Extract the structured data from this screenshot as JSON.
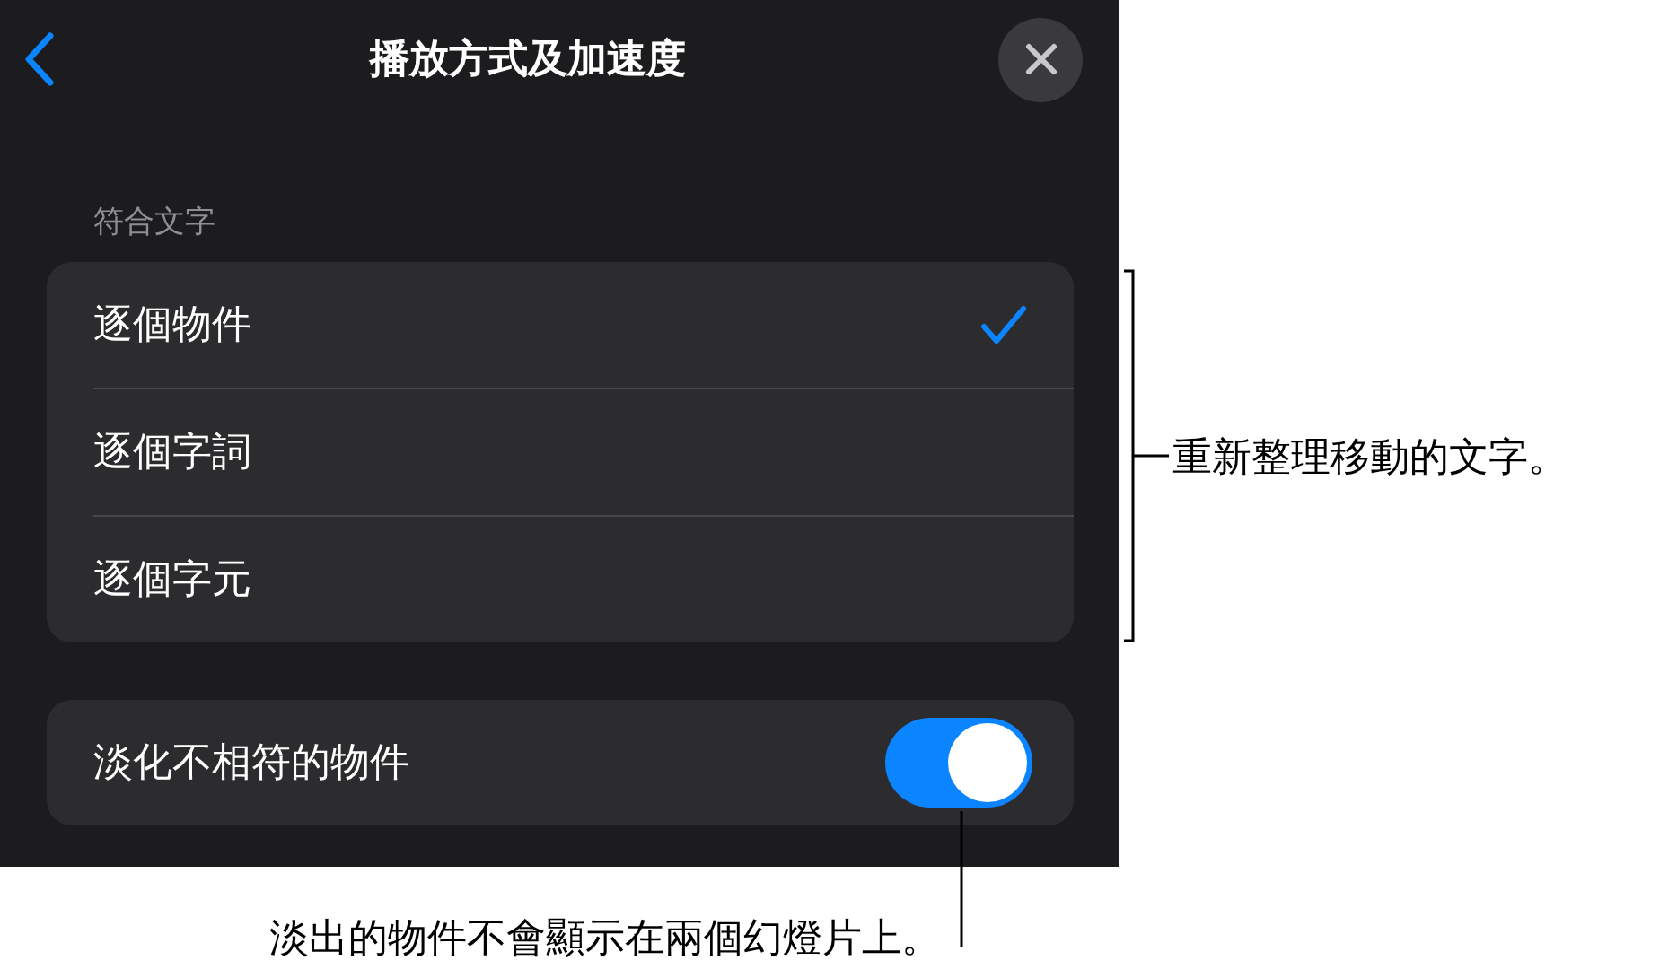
{
  "nav": {
    "title": "播放方式及加速度"
  },
  "section": {
    "label": "符合文字",
    "options": [
      {
        "label": "逐個物件",
        "selected": true
      },
      {
        "label": "逐個字詞",
        "selected": false
      },
      {
        "label": "逐個字元",
        "selected": false
      }
    ]
  },
  "fade_toggle": {
    "label": "淡化不相符的物件",
    "on": true
  },
  "callouts": [
    {
      "kind": "bracket",
      "text": "重新整理移動的文字。"
    },
    {
      "kind": "pointer",
      "text": "淡出的物件不會顯示在兩個幻燈片上。"
    }
  ]
}
